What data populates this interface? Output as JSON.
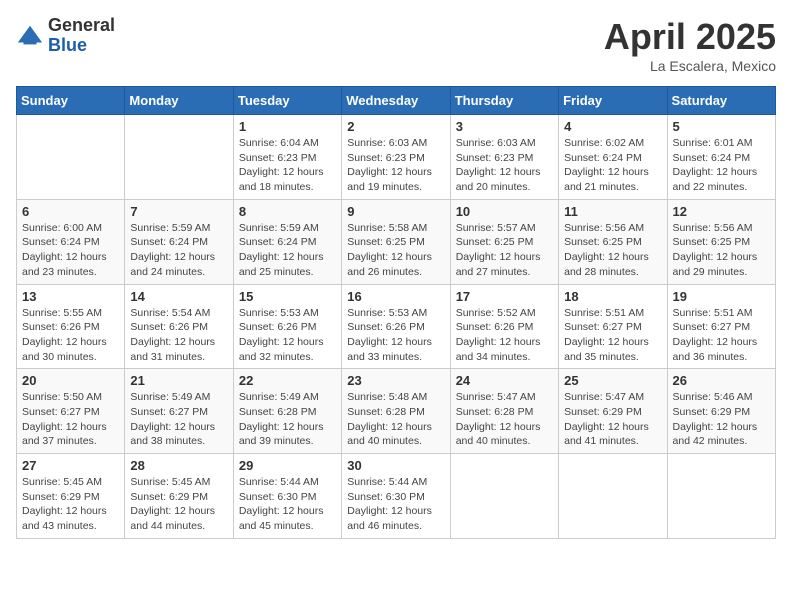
{
  "header": {
    "logo_general": "General",
    "logo_blue": "Blue",
    "title": "April 2025",
    "location": "La Escalera, Mexico"
  },
  "weekdays": [
    "Sunday",
    "Monday",
    "Tuesday",
    "Wednesday",
    "Thursday",
    "Friday",
    "Saturday"
  ],
  "weeks": [
    [
      {
        "day": "",
        "sunrise": "",
        "sunset": "",
        "daylight": ""
      },
      {
        "day": "",
        "sunrise": "",
        "sunset": "",
        "daylight": ""
      },
      {
        "day": "1",
        "sunrise": "Sunrise: 6:04 AM",
        "sunset": "Sunset: 6:23 PM",
        "daylight": "Daylight: 12 hours and 18 minutes."
      },
      {
        "day": "2",
        "sunrise": "Sunrise: 6:03 AM",
        "sunset": "Sunset: 6:23 PM",
        "daylight": "Daylight: 12 hours and 19 minutes."
      },
      {
        "day": "3",
        "sunrise": "Sunrise: 6:03 AM",
        "sunset": "Sunset: 6:23 PM",
        "daylight": "Daylight: 12 hours and 20 minutes."
      },
      {
        "day": "4",
        "sunrise": "Sunrise: 6:02 AM",
        "sunset": "Sunset: 6:24 PM",
        "daylight": "Daylight: 12 hours and 21 minutes."
      },
      {
        "day": "5",
        "sunrise": "Sunrise: 6:01 AM",
        "sunset": "Sunset: 6:24 PM",
        "daylight": "Daylight: 12 hours and 22 minutes."
      }
    ],
    [
      {
        "day": "6",
        "sunrise": "Sunrise: 6:00 AM",
        "sunset": "Sunset: 6:24 PM",
        "daylight": "Daylight: 12 hours and 23 minutes."
      },
      {
        "day": "7",
        "sunrise": "Sunrise: 5:59 AM",
        "sunset": "Sunset: 6:24 PM",
        "daylight": "Daylight: 12 hours and 24 minutes."
      },
      {
        "day": "8",
        "sunrise": "Sunrise: 5:59 AM",
        "sunset": "Sunset: 6:24 PM",
        "daylight": "Daylight: 12 hours and 25 minutes."
      },
      {
        "day": "9",
        "sunrise": "Sunrise: 5:58 AM",
        "sunset": "Sunset: 6:25 PM",
        "daylight": "Daylight: 12 hours and 26 minutes."
      },
      {
        "day": "10",
        "sunrise": "Sunrise: 5:57 AM",
        "sunset": "Sunset: 6:25 PM",
        "daylight": "Daylight: 12 hours and 27 minutes."
      },
      {
        "day": "11",
        "sunrise": "Sunrise: 5:56 AM",
        "sunset": "Sunset: 6:25 PM",
        "daylight": "Daylight: 12 hours and 28 minutes."
      },
      {
        "day": "12",
        "sunrise": "Sunrise: 5:56 AM",
        "sunset": "Sunset: 6:25 PM",
        "daylight": "Daylight: 12 hours and 29 minutes."
      }
    ],
    [
      {
        "day": "13",
        "sunrise": "Sunrise: 5:55 AM",
        "sunset": "Sunset: 6:26 PM",
        "daylight": "Daylight: 12 hours and 30 minutes."
      },
      {
        "day": "14",
        "sunrise": "Sunrise: 5:54 AM",
        "sunset": "Sunset: 6:26 PM",
        "daylight": "Daylight: 12 hours and 31 minutes."
      },
      {
        "day": "15",
        "sunrise": "Sunrise: 5:53 AM",
        "sunset": "Sunset: 6:26 PM",
        "daylight": "Daylight: 12 hours and 32 minutes."
      },
      {
        "day": "16",
        "sunrise": "Sunrise: 5:53 AM",
        "sunset": "Sunset: 6:26 PM",
        "daylight": "Daylight: 12 hours and 33 minutes."
      },
      {
        "day": "17",
        "sunrise": "Sunrise: 5:52 AM",
        "sunset": "Sunset: 6:26 PM",
        "daylight": "Daylight: 12 hours and 34 minutes."
      },
      {
        "day": "18",
        "sunrise": "Sunrise: 5:51 AM",
        "sunset": "Sunset: 6:27 PM",
        "daylight": "Daylight: 12 hours and 35 minutes."
      },
      {
        "day": "19",
        "sunrise": "Sunrise: 5:51 AM",
        "sunset": "Sunset: 6:27 PM",
        "daylight": "Daylight: 12 hours and 36 minutes."
      }
    ],
    [
      {
        "day": "20",
        "sunrise": "Sunrise: 5:50 AM",
        "sunset": "Sunset: 6:27 PM",
        "daylight": "Daylight: 12 hours and 37 minutes."
      },
      {
        "day": "21",
        "sunrise": "Sunrise: 5:49 AM",
        "sunset": "Sunset: 6:27 PM",
        "daylight": "Daylight: 12 hours and 38 minutes."
      },
      {
        "day": "22",
        "sunrise": "Sunrise: 5:49 AM",
        "sunset": "Sunset: 6:28 PM",
        "daylight": "Daylight: 12 hours and 39 minutes."
      },
      {
        "day": "23",
        "sunrise": "Sunrise: 5:48 AM",
        "sunset": "Sunset: 6:28 PM",
        "daylight": "Daylight: 12 hours and 40 minutes."
      },
      {
        "day": "24",
        "sunrise": "Sunrise: 5:47 AM",
        "sunset": "Sunset: 6:28 PM",
        "daylight": "Daylight: 12 hours and 40 minutes."
      },
      {
        "day": "25",
        "sunrise": "Sunrise: 5:47 AM",
        "sunset": "Sunset: 6:29 PM",
        "daylight": "Daylight: 12 hours and 41 minutes."
      },
      {
        "day": "26",
        "sunrise": "Sunrise: 5:46 AM",
        "sunset": "Sunset: 6:29 PM",
        "daylight": "Daylight: 12 hours and 42 minutes."
      }
    ],
    [
      {
        "day": "27",
        "sunrise": "Sunrise: 5:45 AM",
        "sunset": "Sunset: 6:29 PM",
        "daylight": "Daylight: 12 hours and 43 minutes."
      },
      {
        "day": "28",
        "sunrise": "Sunrise: 5:45 AM",
        "sunset": "Sunset: 6:29 PM",
        "daylight": "Daylight: 12 hours and 44 minutes."
      },
      {
        "day": "29",
        "sunrise": "Sunrise: 5:44 AM",
        "sunset": "Sunset: 6:30 PM",
        "daylight": "Daylight: 12 hours and 45 minutes."
      },
      {
        "day": "30",
        "sunrise": "Sunrise: 5:44 AM",
        "sunset": "Sunset: 6:30 PM",
        "daylight": "Daylight: 12 hours and 46 minutes."
      },
      {
        "day": "",
        "sunrise": "",
        "sunset": "",
        "daylight": ""
      },
      {
        "day": "",
        "sunrise": "",
        "sunset": "",
        "daylight": ""
      },
      {
        "day": "",
        "sunrise": "",
        "sunset": "",
        "daylight": ""
      }
    ]
  ]
}
